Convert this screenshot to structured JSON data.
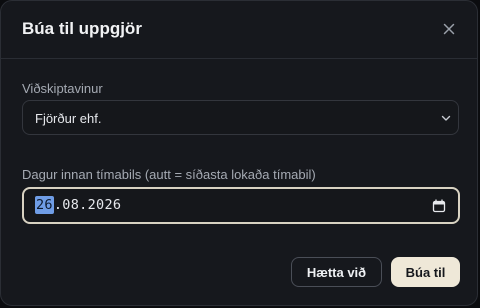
{
  "dialog": {
    "title": "Búa til uppgjör",
    "close_icon": "close-icon"
  },
  "customer": {
    "label": "Viðskiptavinur",
    "selected": "Fjörður ehf.",
    "icon": "chevron-down-icon"
  },
  "period_date": {
    "label": "Dagur innan tímabils (autt = síðasta lokaða tímabil)",
    "day": "26",
    "month": "08",
    "year": "2026",
    "separator": ".",
    "icon": "calendar-icon"
  },
  "actions": {
    "cancel_label": "Hætta við",
    "create_label": "Búa til"
  },
  "colors": {
    "background": "#16181d",
    "focus_border": "#d8d2c2",
    "primary_button": "#efe8d8",
    "selection": "#6f9de6"
  }
}
